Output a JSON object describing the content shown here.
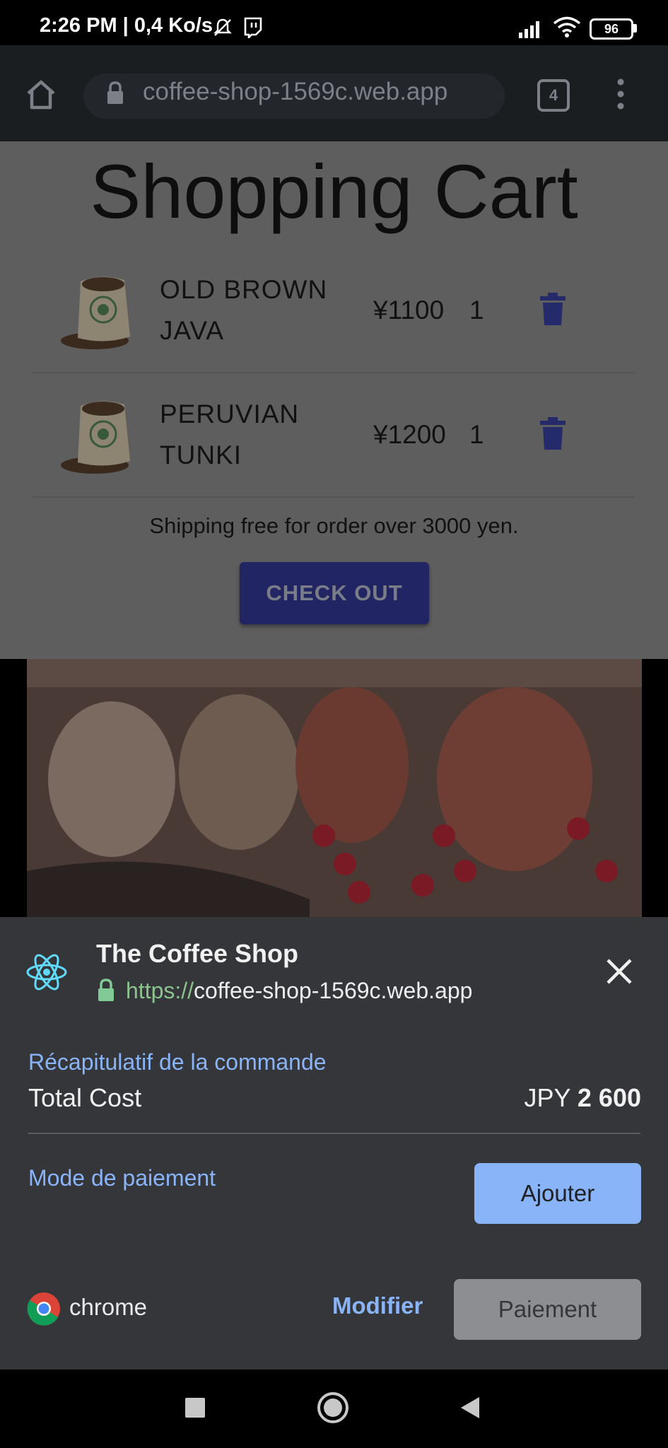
{
  "status_bar": {
    "time": "2:26 PM | 0,4 Ko/s",
    "battery": "96"
  },
  "browser": {
    "url": "coffee-shop-1569c.web.app",
    "tab_count": "4"
  },
  "cart": {
    "title": "Shopping Cart",
    "items": [
      {
        "name_line1": "OLD BROWN",
        "name_line2": "JAVA",
        "price": "¥1100",
        "qty": "1"
      },
      {
        "name_line1": "PERUVIAN",
        "name_line2": "TUNKI",
        "price": "¥1200",
        "qty": "1"
      }
    ],
    "shipping_note": "Shipping free for order over 3000 yen.",
    "checkout_label": "CHECK OUT"
  },
  "payment_sheet": {
    "shop_name": "The Coffee Shop",
    "url_protocol": "https://",
    "url_host": "coffee-shop-1569c.web.app",
    "order_summary_label": "Récapitulatif de la commande",
    "total_label": "Total Cost",
    "currency": "JPY",
    "total_amount": "2 600",
    "payment_method_label": "Mode de paiement",
    "add_label": "Ajouter",
    "brand": "chrome",
    "edit_label": "Modifier",
    "pay_label": "Paiement"
  },
  "colors": {
    "accent_blue": "#8ab4f8",
    "sheet_bg": "#35363a",
    "checkout_bg": "#222563",
    "trash_icon": "#252a6b"
  }
}
